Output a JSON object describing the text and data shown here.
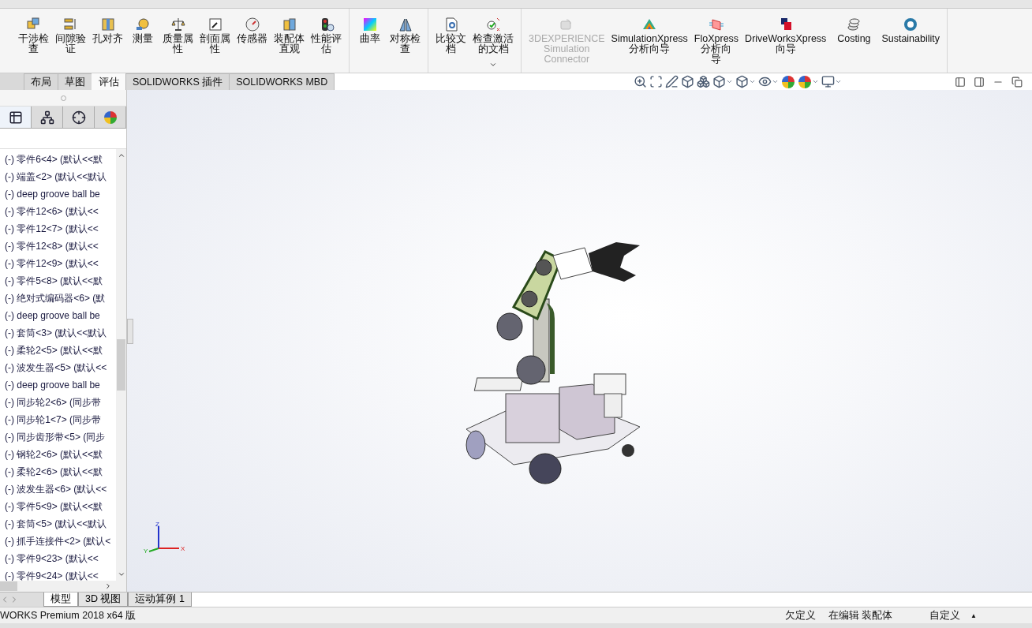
{
  "ribbon": {
    "groups": [
      {
        "items": [
          {
            "kind": "interference",
            "lines": [
              "干涉检",
              "查"
            ]
          },
          {
            "kind": "clearance",
            "lines": [
              "间隙验",
              "证"
            ]
          },
          {
            "kind": "hole",
            "lines": [
              "孔对齐"
            ]
          },
          {
            "kind": "measure",
            "lines": [
              "测量"
            ]
          },
          {
            "kind": "mass",
            "lines": [
              "质量属",
              "性"
            ]
          },
          {
            "kind": "section",
            "lines": [
              "剖面属",
              "性"
            ]
          },
          {
            "kind": "sensor",
            "lines": [
              "传感器"
            ]
          },
          {
            "kind": "visual",
            "lines": [
              "装配体",
              "直观"
            ]
          },
          {
            "kind": "perf",
            "lines": [
              "性能评",
              "估"
            ]
          }
        ]
      },
      {
        "items": [
          {
            "kind": "curv",
            "lines": [
              "曲率"
            ]
          },
          {
            "kind": "sym",
            "lines": [
              "对称检",
              "查"
            ]
          }
        ]
      },
      {
        "items": [
          {
            "kind": "compare",
            "lines": [
              "比较文",
              "档"
            ]
          },
          {
            "kind": "check",
            "lines": [
              "检查激活",
              "的文档"
            ],
            "dropdown": true
          }
        ]
      },
      {
        "items": [
          {
            "kind": "cloud",
            "lines": [
              "3DEXPERIENCE",
              "Simulation",
              "Connector"
            ],
            "disabled": true
          },
          {
            "kind": "simx",
            "lines": [
              "SimulationXpress",
              "分析向导"
            ]
          },
          {
            "kind": "flox",
            "lines": [
              "FloXpress",
              "分析向",
              "导"
            ]
          },
          {
            "kind": "drive",
            "lines": [
              "DriveWorksXpress",
              "向导"
            ]
          },
          {
            "kind": "cost",
            "lines": [
              "Costing"
            ]
          },
          {
            "kind": "sust",
            "lines": [
              "Sustainability"
            ]
          }
        ]
      }
    ]
  },
  "command_tabs": [
    {
      "label": "布局",
      "selected": false
    },
    {
      "label": "草图",
      "selected": false
    },
    {
      "label": "评估",
      "selected": true
    },
    {
      "label": "SOLIDWORKS 插件",
      "selected": false
    },
    {
      "label": "SOLIDWORKS MBD",
      "selected": false
    }
  ],
  "panel_tabs": [
    {
      "kind": "tree",
      "selected": true
    },
    {
      "kind": "property",
      "selected": false
    },
    {
      "kind": "config",
      "selected": false
    },
    {
      "kind": "display",
      "selected": false
    }
  ],
  "tree_items": [
    "(-) 零件6<4> (默认<<默",
    "(-) 端盖<2> (默认<<默认",
    "(-) deep groove ball be",
    "(-) 零件12<6> (默认<<",
    "(-) 零件12<7> (默认<<",
    "(-) 零件12<8> (默认<<",
    "(-) 零件12<9> (默认<<",
    "(-) 零件5<8> (默认<<默",
    "(-) 绝对式编码器<6> (默",
    "(-) deep groove ball be",
    "(-) 套筒<3> (默认<<默认",
    "(-) 柔轮2<5> (默认<<默",
    "(-) 波发生器<5> (默认<<",
    "(-) deep groove ball be",
    "(-) 同步轮2<6> (同步带",
    "(-) 同步轮1<7> (同步带",
    "(-) 同步齿形带<5> (同步",
    "(-) 钢轮2<6> (默认<<默",
    "(-) 柔轮2<6> (默认<<默",
    "(-) 波发生器<6> (默认<<",
    "(-) 零件5<9> (默认<<默",
    "(-) 套筒<5> (默认<<默认",
    "(-) 抓手连接件<2> (默认<",
    "(-) 零件9<23> (默认<<",
    "(-) 零件9<24> (默认<<"
  ],
  "bottom_tabs": [
    {
      "label": "模型",
      "selected": true
    },
    {
      "label": "3D 视图",
      "selected": false
    },
    {
      "label": "运动算例 1",
      "selected": false
    }
  ],
  "triad": {
    "x": "X",
    "y": "Y",
    "z": "Z"
  },
  "status_bar": {
    "product": "WORKS Premium 2018 x64 版",
    "state": "欠定义",
    "mode": "在编辑 装配体",
    "units": "自定义",
    "units_caret": "▲"
  }
}
